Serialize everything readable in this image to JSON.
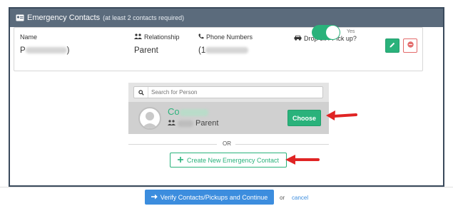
{
  "header": {
    "title": "Emergency Contacts",
    "subtitle": "(at least 2 contacts required)"
  },
  "contact": {
    "name_label": "Name",
    "name_value_start": "P",
    "name_value_end": ")",
    "relationship_label": "Relationship",
    "relationship_value": "Parent",
    "phone_label": "Phone Numbers",
    "phone_value_start": "(1",
    "dropoff_label": "Drop off / Pick up?",
    "dropoff_toggle_text": "Yes",
    "dropoff_on": true
  },
  "search": {
    "placeholder": "Search for Person",
    "value": ""
  },
  "result": {
    "name_start": "Co",
    "relationship": "Parent",
    "choose_label": "Choose"
  },
  "divider_or": "OR",
  "create_label": "Create New Emergency Contact",
  "footer": {
    "verify_label": "Verify Contacts/Pickups and Continue",
    "or_text": "or",
    "cancel_label": "cancel"
  },
  "colors": {
    "header_bg": "#5b6b7c",
    "green": "#2ab27b",
    "blue": "#3c8dde",
    "red_arrow": "#e02424",
    "danger": "#e36a6a"
  }
}
